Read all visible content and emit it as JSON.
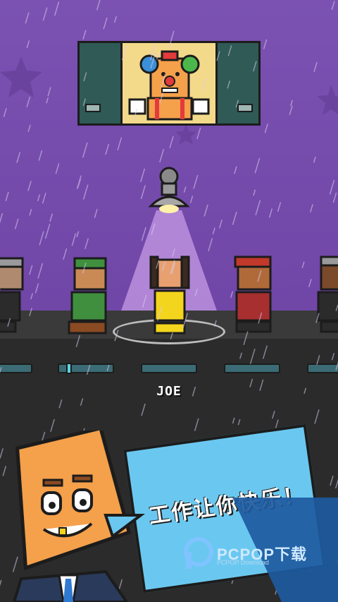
{
  "game": {
    "selected_character_name": "JOE",
    "speech_bubble_text": "工作让你快乐！"
  },
  "watermark": {
    "brand": "PCPOP下载",
    "sub": "PCPOP Download"
  },
  "colors": {
    "background_purple": "#7b52b2",
    "floor": "#2b2b2b",
    "spotlight": "#c79be6",
    "bubble_blue": "#6ac8f0",
    "boss_orange": "#f5a04a",
    "selected_outfit_yellow": "#f4d51d"
  },
  "characters": [
    {
      "id": "left-edge",
      "outfit": "gray"
    },
    {
      "id": "green-cap",
      "outfit": "green"
    },
    {
      "id": "selected",
      "outfit": "yellow"
    },
    {
      "id": "red-hair",
      "outfit": "red"
    },
    {
      "id": "right-edge",
      "outfit": "gray"
    }
  ]
}
